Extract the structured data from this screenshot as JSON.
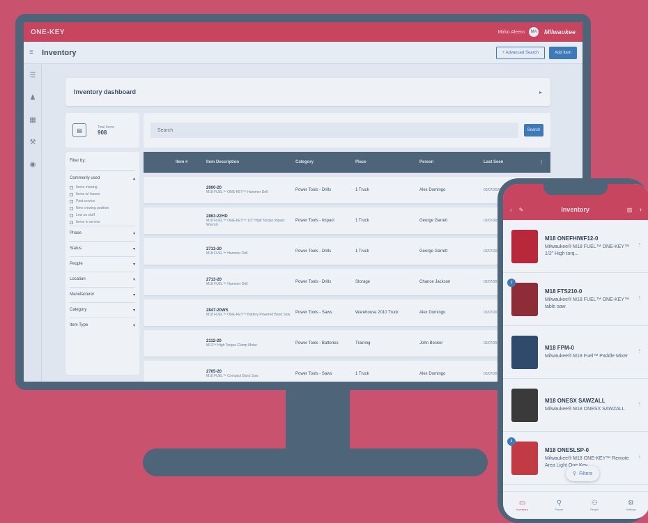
{
  "desktop": {
    "topbar": {
      "logo": "ONE-KEY",
      "user_name": "Mirko Aleem",
      "user_initials": "MA",
      "brand": "Milwaukee"
    },
    "header": {
      "title": "Inventory",
      "outline_button": "+ Advanced Search",
      "solid_button": "Add Item"
    },
    "dashboard": {
      "title": "Inventory dashboard"
    },
    "summary": {
      "label": "Total Items",
      "value": "908"
    },
    "search": {
      "placeholder": "Search",
      "button": "Search"
    },
    "filters": {
      "title": "Filter by:",
      "group": "Commonly used",
      "checks": [
        "Items missing",
        "Items w/ Issues",
        "Past service",
        "New crewing position",
        "Low on stuff",
        "Items in service"
      ],
      "rows": [
        "Phase",
        "Status",
        "People",
        "Location",
        "Manufacturer",
        "Category",
        "Item Type"
      ]
    },
    "table": {
      "headers": [
        "",
        "Item #",
        "Item Description",
        "Category",
        "Place",
        "Person",
        "Last Seen",
        ""
      ],
      "rows": [
        {
          "num": "2000-20",
          "desc": "M18 FUEL™ ONE-KEY™ Hammer Drill",
          "cat": "Power Tools - Drills",
          "place": "1 Truck",
          "person": "Alex Domingo",
          "seen": "02/07/2020 8:18 pm"
        },
        {
          "num": "2863-22HD",
          "desc": "M18 FUEL™ ONE-KEY™ 1/2\" High Torque Impact Wrench",
          "cat": "Power Tools - Impact",
          "place": "1 Truck",
          "person": "George Garrett",
          "seen": "02/07/2020 8:18 pm"
        },
        {
          "num": "2713-20",
          "desc": "M18 FUEL™ Hammer Drill",
          "cat": "Power Tools - Drills",
          "place": "1 Truck",
          "person": "George Garrett",
          "seen": "02/07/2020 8:18 pm"
        },
        {
          "num": "2713-20",
          "desc": "M18 FUEL™ Hammer Drill",
          "cat": "Power Tools - Drills",
          "place": "Storage",
          "person": "Chance Jackson",
          "seen": "02/07/2020 8:18 pm"
        },
        {
          "num": "2847-20WS",
          "desc": "M18 FUEL™ ONE-KEY™ Battery Powered Band Saw",
          "cat": "Power Tools - Saws",
          "place": "Warehouse 2010 Truck",
          "person": "Alex Domingo",
          "seen": "02/07/2020 8:18 pm"
        },
        {
          "num": "2112-20",
          "desc": "M12™ High Torque Clamp Meter",
          "cat": "Power Tools - Batteries",
          "place": "Training",
          "person": "John Becker",
          "seen": "02/07/2020 8:18 pm"
        },
        {
          "num": "2705-20",
          "desc": "M18 FUEL™ Compact Band Saw",
          "cat": "Power Tools - Saws",
          "place": "1 Truck",
          "person": "Alex Domingo",
          "seen": "02/07/2020 8:18 pm"
        }
      ]
    }
  },
  "mobile": {
    "header": {
      "title": "Inventory"
    },
    "items": [
      {
        "model": "M18 ONEFHIWF12-0",
        "desc": "Milwaukee® M18 FUEL™ ONE-KEY™ 1/2\" High torq...",
        "badge": "",
        "thumb_color": "#b8283a"
      },
      {
        "model": "M18 FTS210-0",
        "desc": "Milwaukee® M18 FUEL™ ONE-KEY™ table saw",
        "badge": "2",
        "thumb_color": "#8e2d37"
      },
      {
        "model": "M18 FPM-0",
        "desc": "Milwaukee® M18 Fuel™ Paddle Mixer",
        "badge": "",
        "thumb_color": "#2f4a6a"
      },
      {
        "model": "M18 ONESX SAWZALL",
        "desc": "Milwaukee® M18 ONESX SAWZALL",
        "badge": "",
        "thumb_color": "#3a3a3a"
      },
      {
        "model": "M18 ONESLSP-0",
        "desc": "Milwaukee® M18 ONE-KEY™ Remote Area Light One Key",
        "badge": "4",
        "thumb_color": "#c23a44"
      }
    ],
    "filters_pill": "Filters",
    "tabs": [
      "Inventory",
      "Places",
      "People",
      "Settings"
    ]
  }
}
